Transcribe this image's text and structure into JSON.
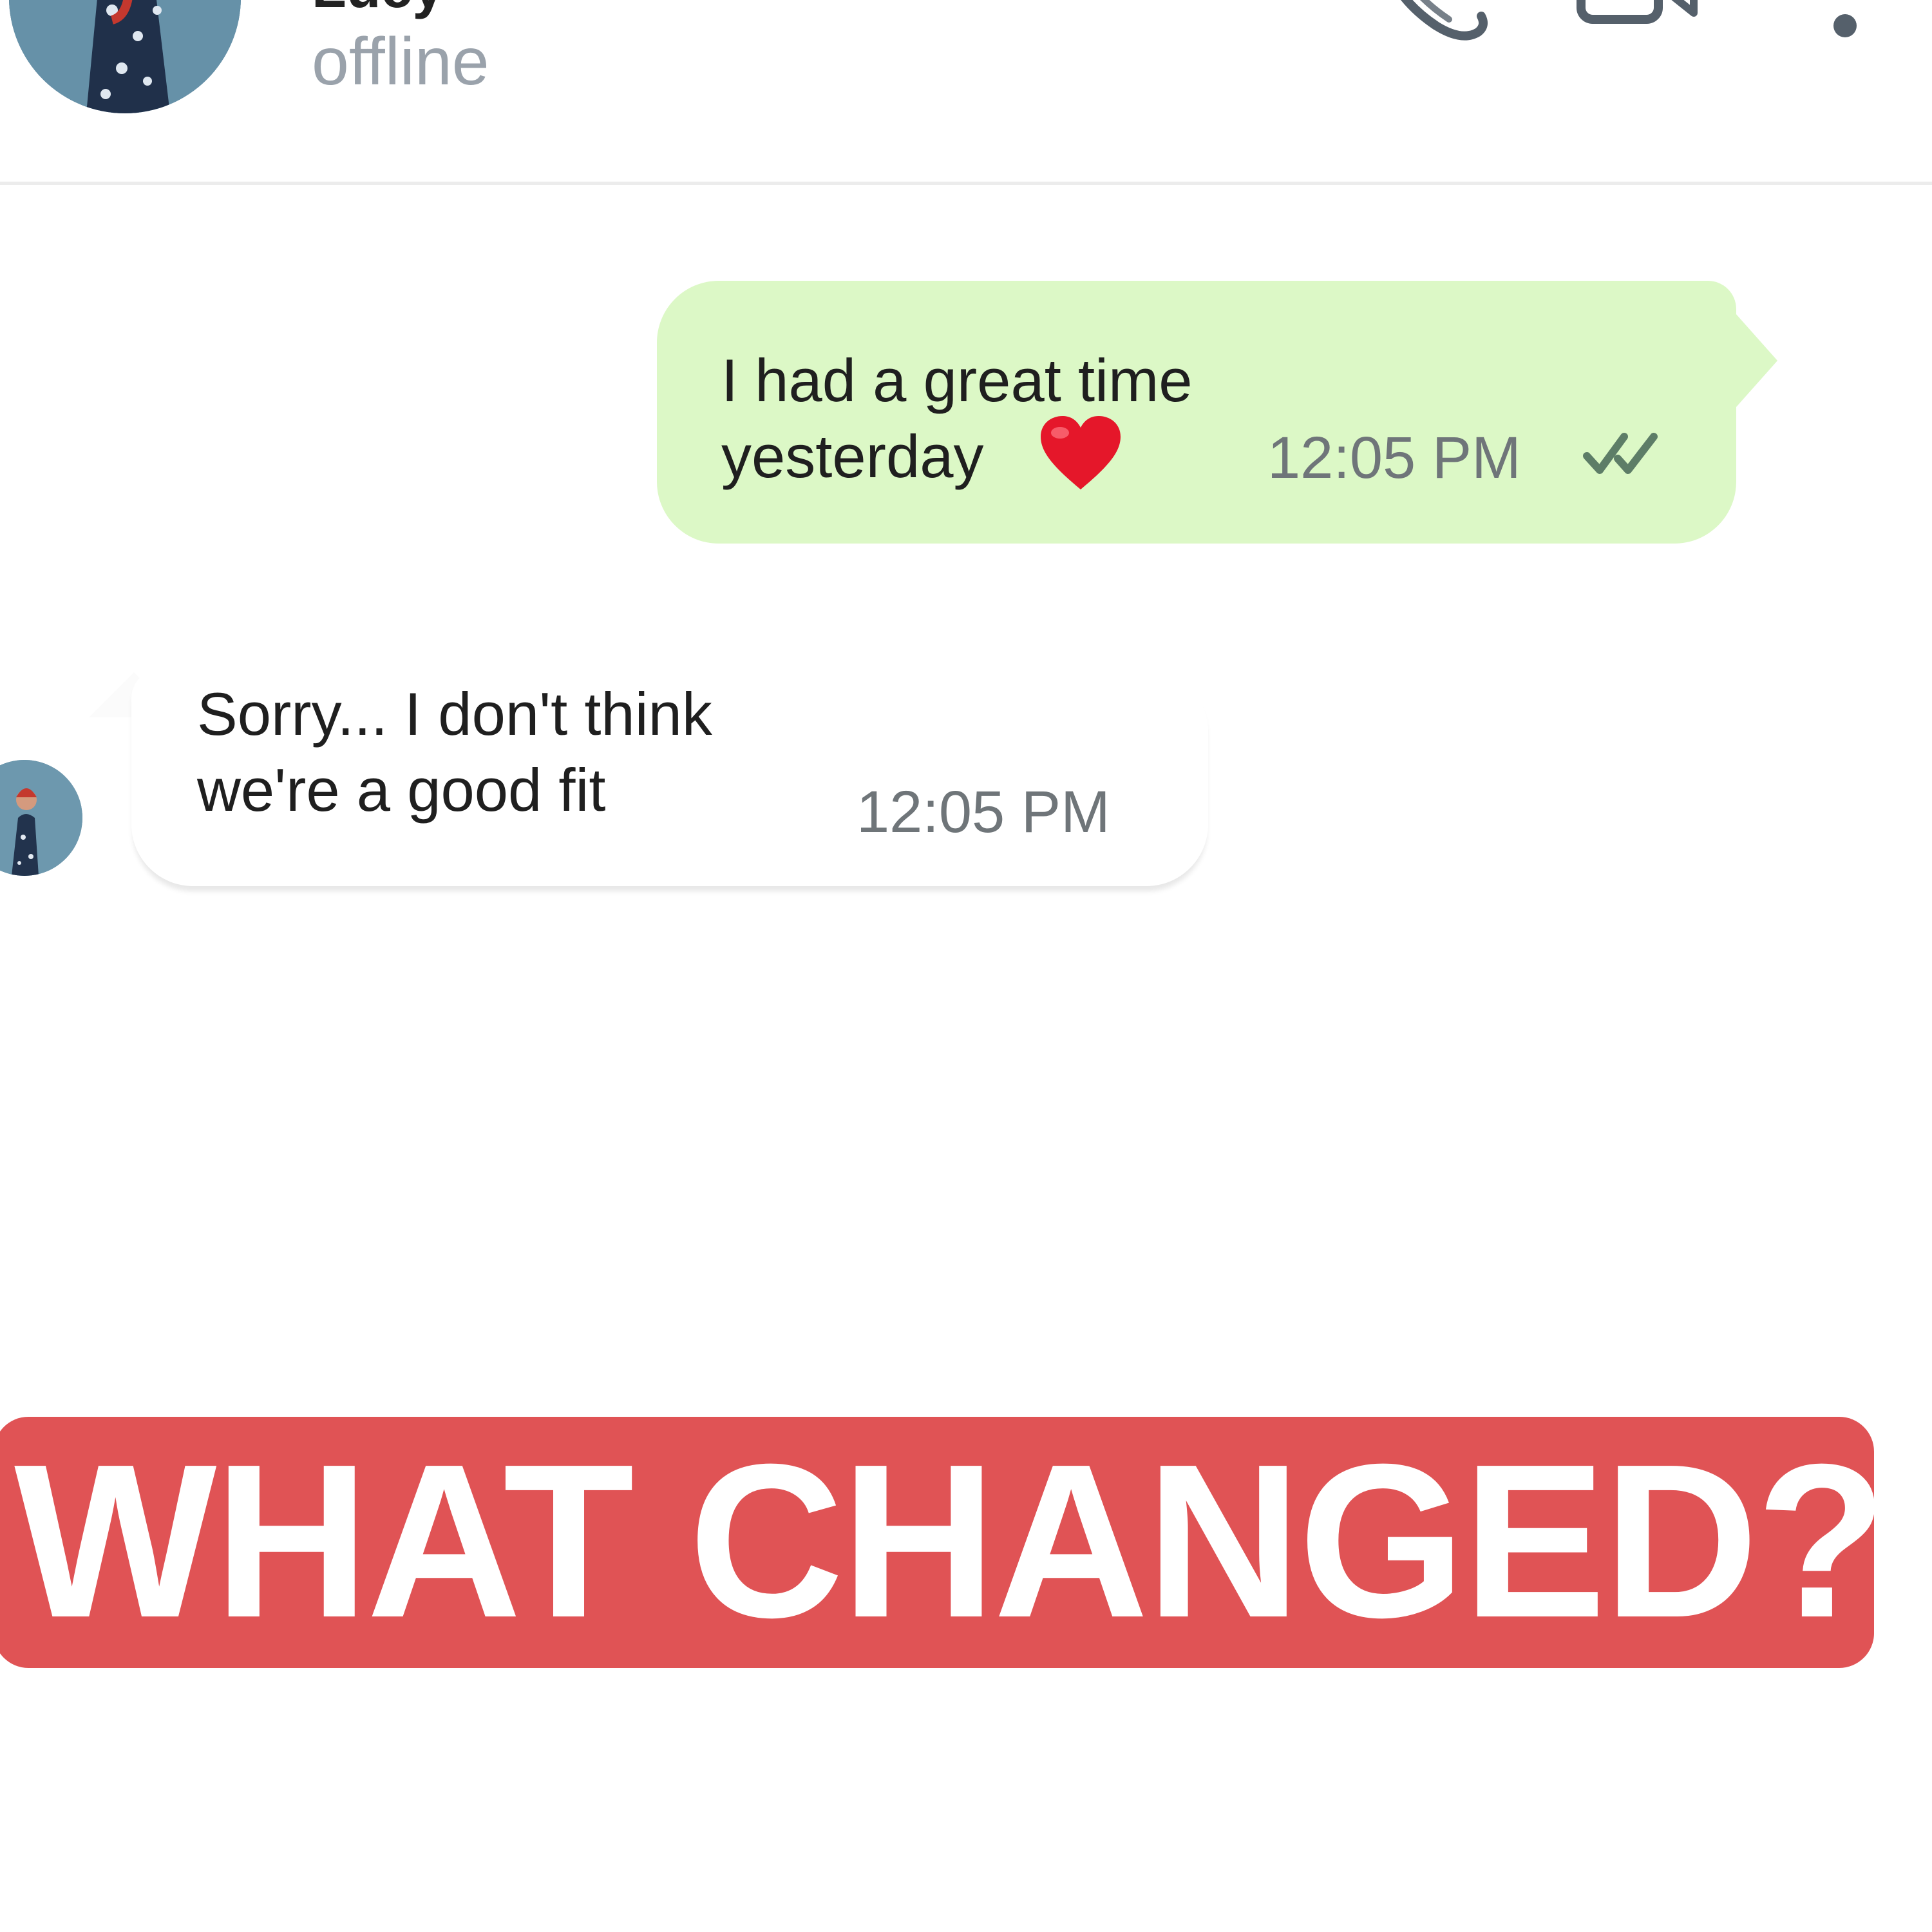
{
  "header": {
    "contact_name": "Lucy",
    "status": "offline",
    "icons": [
      "avatar",
      "phone-icon",
      "video-icon",
      "more-menu-icon"
    ]
  },
  "messages": [
    {
      "direction": "outgoing",
      "lines": [
        "I had a great time",
        "yesterday"
      ],
      "emoji": "heart",
      "time": "12:05 PM",
      "read_receipt": "double-check"
    },
    {
      "direction": "incoming",
      "lines": [
        "Sorry... I don't think",
        "we're a good fit"
      ],
      "time": "12:05 PM"
    }
  ],
  "banner": {
    "text": "WHAT CHANGED?"
  },
  "colors": {
    "outgoing_bubble": "#dcf8c6",
    "incoming_bubble": "#ffffff",
    "banner": "#e05355",
    "status_text": "#9aa2ab",
    "timestamp": "#6f7579",
    "ticks": "#5d7d67"
  }
}
